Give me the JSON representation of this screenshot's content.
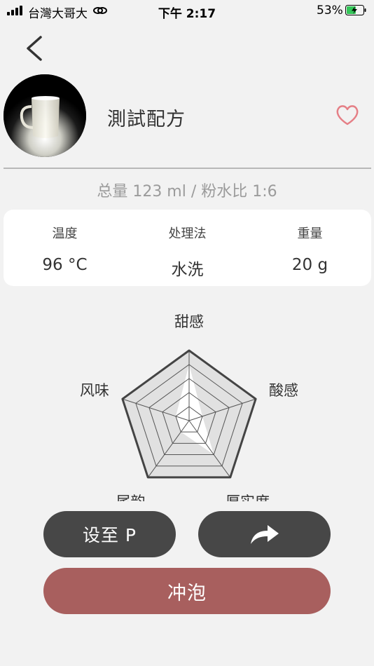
{
  "status_bar": {
    "carrier": "台灣大哥大",
    "time": "下午 2:17",
    "battery_pct": "53%"
  },
  "header": {
    "back_icon": "chevron-left-icon",
    "recipe_title": "測試配方",
    "favorite_icon": "heart-outline-icon",
    "favorite_color": "#e57f86"
  },
  "summary": "总量 123 ml / 粉水比 1:6",
  "info": [
    {
      "label": "温度",
      "value": "96 °C"
    },
    {
      "label": "处理法",
      "value": "水洗"
    },
    {
      "label": "重量",
      "value": "20 g"
    }
  ],
  "chart_data": {
    "type": "radar",
    "axes": [
      "甜感",
      "酸感",
      "厚实度",
      "尾韵",
      "风味"
    ],
    "levels": 5,
    "max": 5,
    "series": [
      {
        "values": [
          4,
          1,
          3,
          1,
          1
        ],
        "fill": "#ffffff"
      }
    ],
    "grid_fill": "#e1e1e1",
    "outline_color": "#444444"
  },
  "buttons": {
    "set_p": "设至 P",
    "share_icon": "share-arrow-icon",
    "brew": "冲泡"
  },
  "colors": {
    "dark_button": "#474747",
    "brew_button": "#a85f5e",
    "background": "#f2f2f2"
  }
}
